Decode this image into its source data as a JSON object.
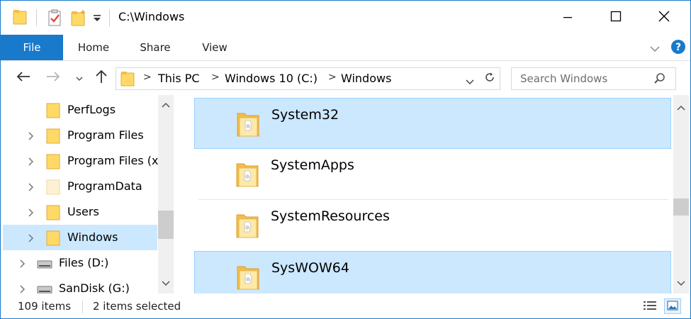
{
  "window": {
    "title": "C:\\Windows",
    "accent": "#1979ca",
    "controls": {
      "minimize_icon": "minimize-icon",
      "maximize_icon": "maximize-icon",
      "close_icon": "close-icon"
    }
  },
  "quick_access": [
    {
      "icon": "folder-icon"
    },
    {
      "icon": "properties-checklist-icon"
    },
    {
      "icon": "new-folder-icon"
    },
    {
      "icon": "customize-dropdown-icon"
    }
  ],
  "ribbon": {
    "tabs": [
      "File",
      "Home",
      "Share",
      "View"
    ],
    "expand_icon": "chevron-down-icon",
    "help_icon": "help-icon"
  },
  "navigation": {
    "back_icon": "back-arrow-icon",
    "forward_icon": "forward-arrow-icon",
    "recent_icon": "recent-locations-icon",
    "up_icon": "up-arrow-icon"
  },
  "address": {
    "breadcrumbs": [
      "This PC",
      "Windows 10 (C:)",
      "Windows"
    ],
    "separator": ">",
    "dropdown_icon": "chevron-down-icon",
    "refresh_icon": "refresh-icon"
  },
  "search": {
    "placeholder": "Search Windows",
    "value": ""
  },
  "nav_tree": {
    "items": [
      {
        "label": "PerfLogs",
        "expandable": false,
        "selected": false,
        "icon": "folder-icon"
      },
      {
        "label": "Program Files",
        "expandable": true,
        "selected": false,
        "icon": "folder-icon"
      },
      {
        "label": "Program Files (x",
        "expandable": true,
        "selected": false,
        "icon": "folder-icon"
      },
      {
        "label": "ProgramData",
        "expandable": true,
        "selected": false,
        "icon": "folder-hidden-icon"
      },
      {
        "label": "Users",
        "expandable": true,
        "selected": false,
        "icon": "folder-icon"
      },
      {
        "label": "Windows",
        "expandable": true,
        "selected": true,
        "icon": "folder-icon"
      },
      {
        "label": "Files (D:)",
        "expandable": true,
        "selected": false,
        "icon": "drive-icon"
      },
      {
        "label": "SanDisk (G:)",
        "expandable": true,
        "selected": false,
        "icon": "drive-icon"
      }
    ]
  },
  "files": [
    {
      "name": "System32",
      "selected": true,
      "icon": "system-folder-icon"
    },
    {
      "name": "SystemApps",
      "selected": false,
      "icon": "system-folder-icon"
    },
    {
      "name": "SystemResources",
      "selected": false,
      "icon": "system-folder-icon"
    },
    {
      "name": "SysWOW64",
      "selected": true,
      "icon": "system-folder-icon"
    }
  ],
  "status": {
    "item_count": "109 items",
    "selection": "2 items selected",
    "details_view_icon": "details-view-icon",
    "large_icons_view_icon": "large-icons-view-icon"
  },
  "colors": {
    "selection_bg": "#cce8ff",
    "selection_border": "#99d1ff",
    "folder_yellow": "#ffd966"
  }
}
